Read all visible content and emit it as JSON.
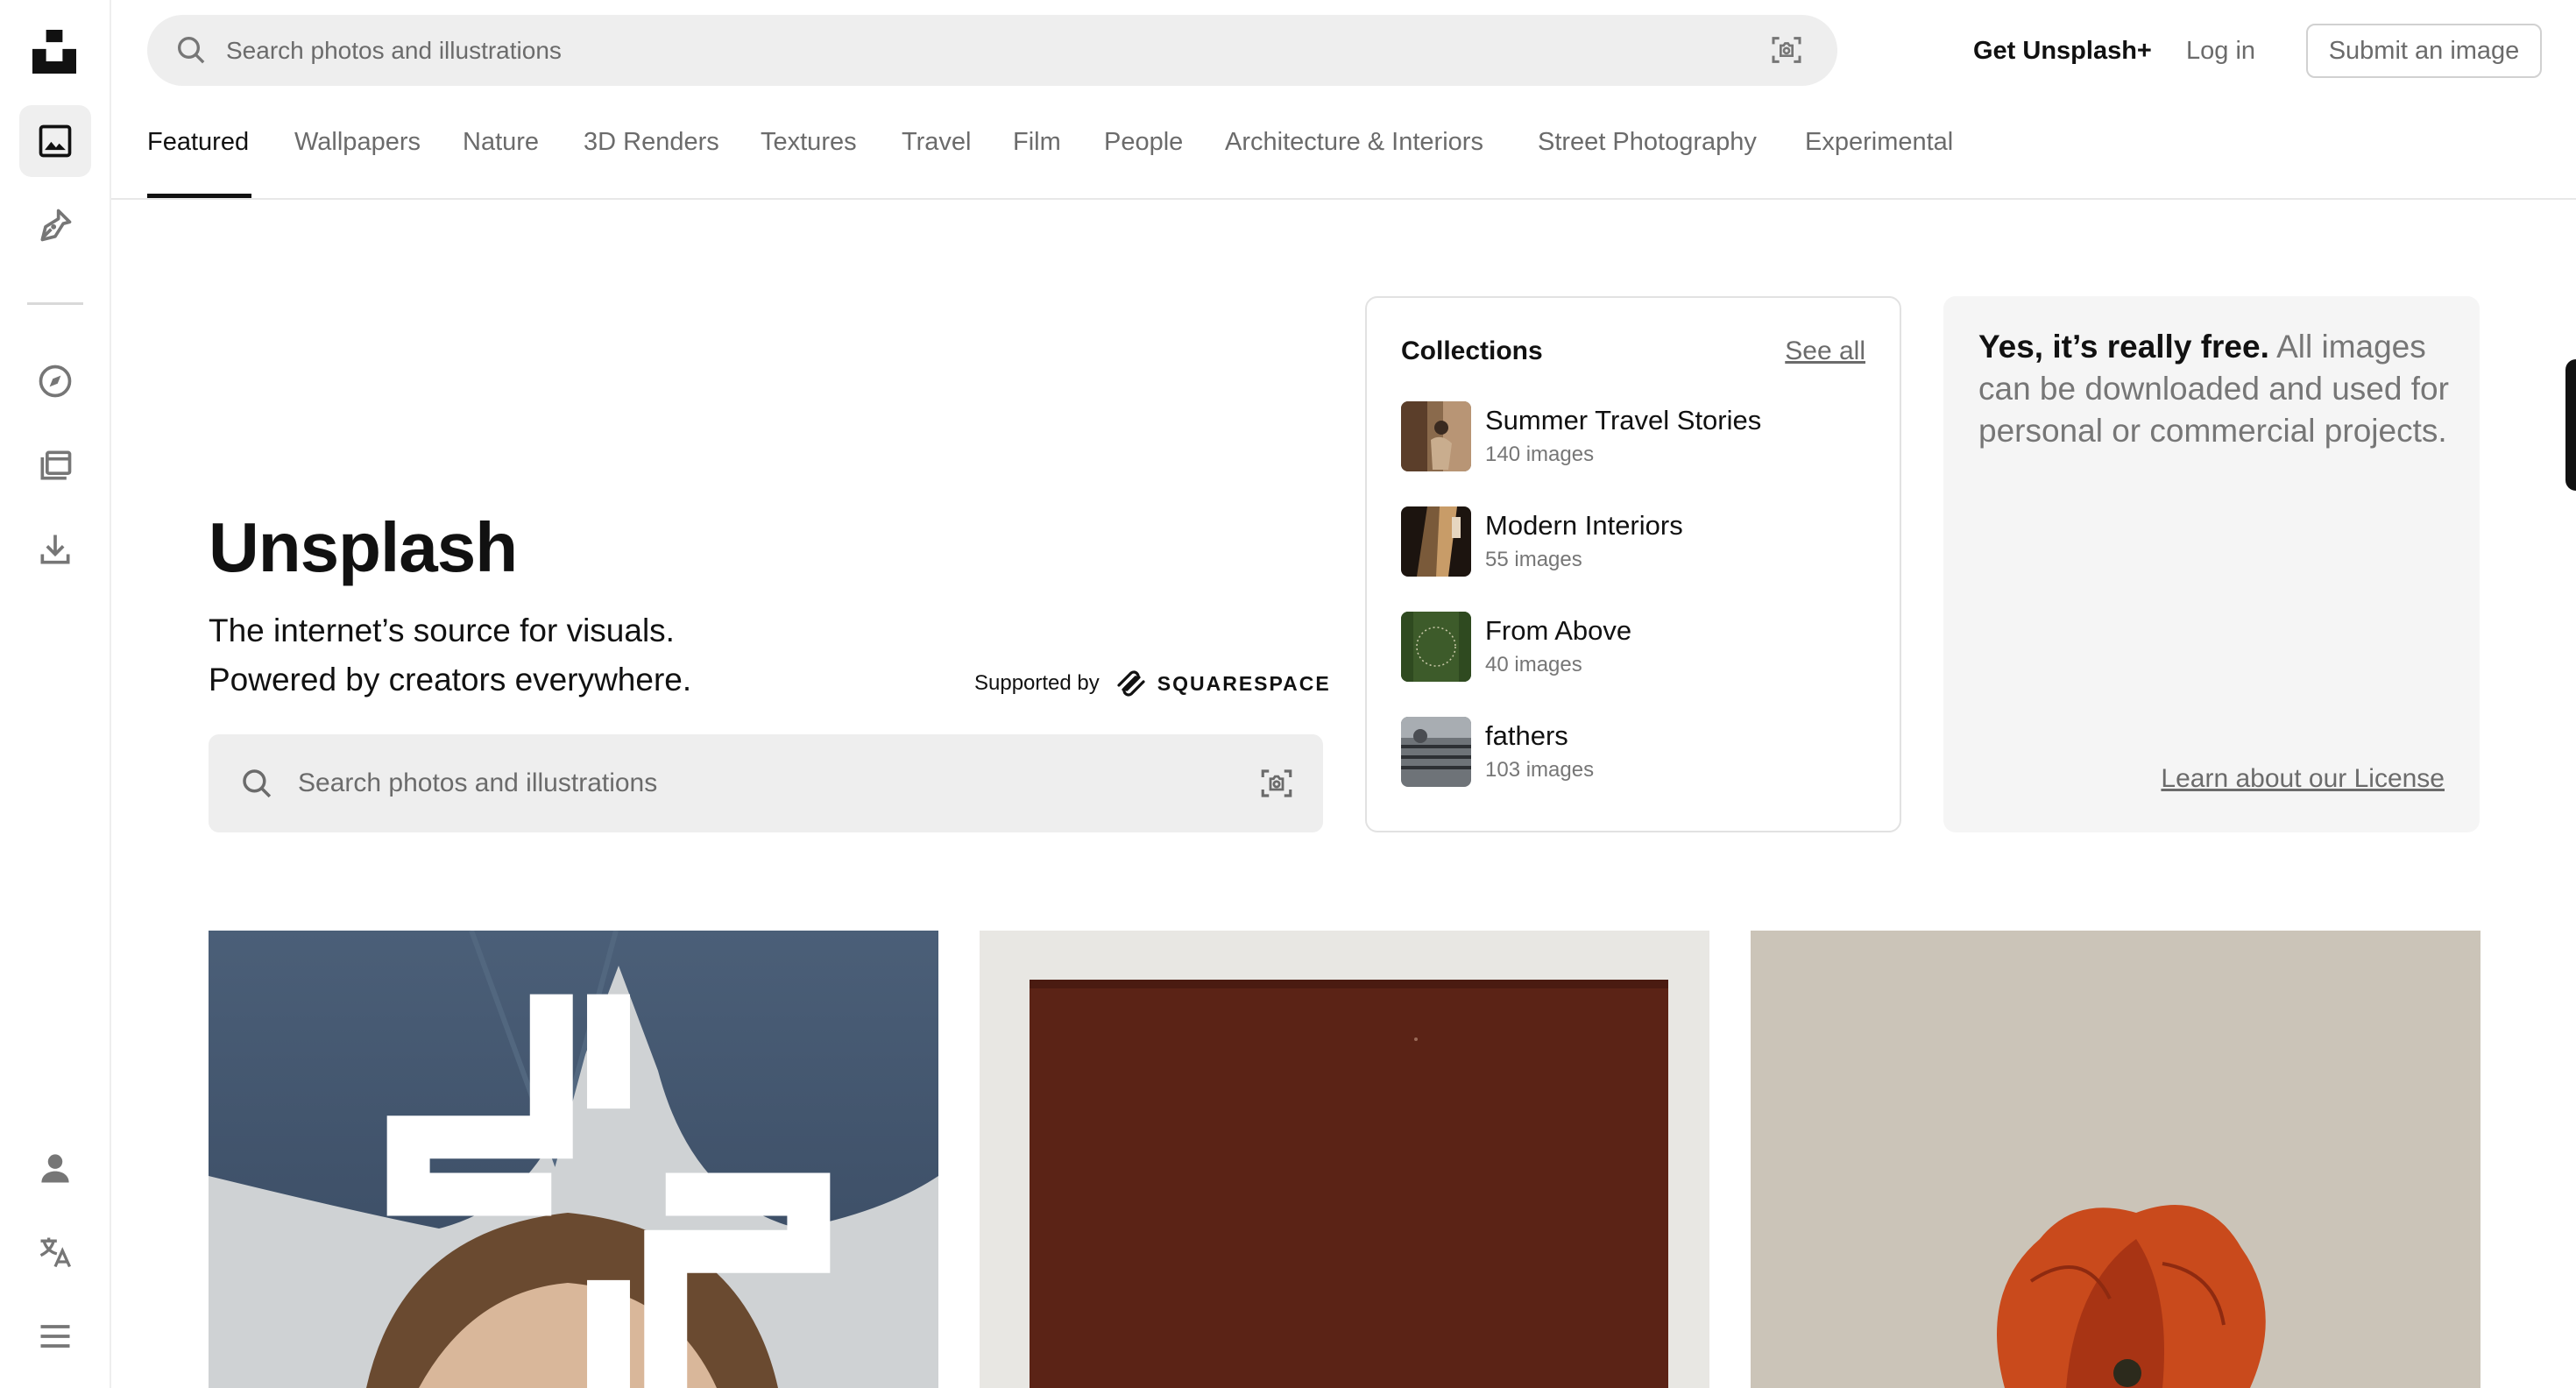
{
  "header": {
    "search_placeholder": "Search photos and illustrations",
    "get_plus": "Get Unsplash+",
    "login": "Log in",
    "submit": "Submit an image"
  },
  "sidebar": {
    "items": [
      {
        "name": "photos",
        "icon": "image-icon",
        "active": true
      },
      {
        "name": "illustrations",
        "icon": "pen-nib-icon"
      },
      {
        "name": "explore",
        "icon": "compass-icon"
      },
      {
        "name": "collections",
        "icon": "collections-icon"
      },
      {
        "name": "downloads",
        "icon": "download-icon"
      },
      {
        "name": "account",
        "icon": "user-icon"
      },
      {
        "name": "language",
        "icon": "translate-icon"
      },
      {
        "name": "menu",
        "icon": "hamburger-menu-icon"
      }
    ]
  },
  "tabs": [
    "Featured",
    "Wallpapers",
    "Nature",
    "3D Renders",
    "Textures",
    "Travel",
    "Film",
    "People",
    "Architecture & Interiors",
    "Street Photography",
    "Experimental"
  ],
  "active_tab": "Featured",
  "hero": {
    "title": "Unsplash",
    "line1": "The internet’s source for visuals.",
    "line2": "Powered by creators everywhere.",
    "supported_by": "Supported by",
    "sponsor": "SQUARESPACE",
    "search_placeholder": "Search photos and illustrations"
  },
  "collections": {
    "title": "Collections",
    "see_all": "See all",
    "items": [
      {
        "name": "Summer Travel Stories",
        "count": "140 images"
      },
      {
        "name": "Modern Interiors",
        "count": "55 images"
      },
      {
        "name": "From Above",
        "count": "40 images"
      },
      {
        "name": "fathers",
        "count": "103 images"
      }
    ]
  },
  "license": {
    "bold": "Yes, it’s really free.",
    "rest": " All images can be downloaded and used for personal or commercial projects.",
    "learn": "Learn about our License"
  },
  "colors": {
    "accent": "#111111",
    "muted_text": "#6b6b6b",
    "search_bg": "#eeeeee",
    "card_bg": "#f5f5f5"
  }
}
